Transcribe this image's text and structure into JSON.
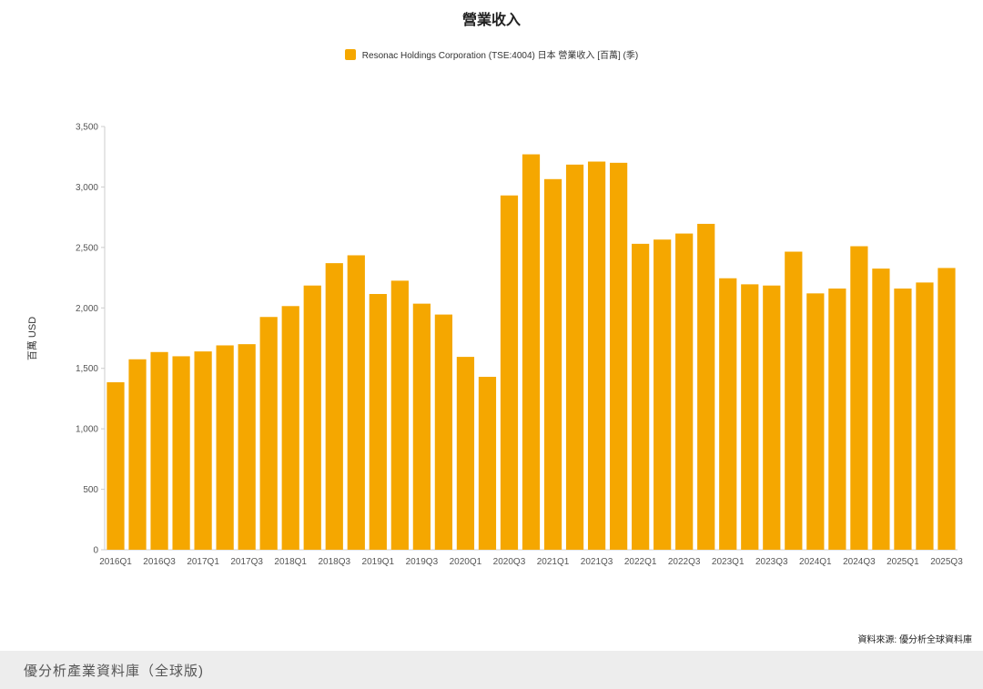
{
  "title": "營業收入",
  "legend_label": "Resonac Holdings Corporation (TSE:4004) 日本 營業收入 [百萬] (季)",
  "source_text": "資料來源: 優分析全球資料庫",
  "footer_text": "優分析產業資料庫（全球版)",
  "colors": {
    "bar": "#f5a700",
    "axis": "#cccccc",
    "text": "#555555"
  },
  "chart_data": {
    "type": "bar",
    "title": "營業收入",
    "ylabel": "百萬 USD",
    "xlabel": "",
    "ylim": [
      0,
      3500
    ],
    "yticks": [
      0,
      500,
      1000,
      1500,
      2000,
      2500,
      3000,
      3500
    ],
    "ytick_labels": [
      "0",
      "500",
      "1,000",
      "1,500",
      "2,000",
      "2,500",
      "3,000",
      "3,500"
    ],
    "grid": false,
    "legend_position": "top-center",
    "categories": [
      "2016Q1",
      "2016Q2",
      "2016Q3",
      "2016Q4",
      "2017Q1",
      "2017Q2",
      "2017Q3",
      "2017Q4",
      "2018Q1",
      "2018Q2",
      "2018Q3",
      "2018Q4",
      "2019Q1",
      "2019Q2",
      "2019Q3",
      "2019Q4",
      "2020Q1",
      "2020Q2",
      "2020Q3",
      "2020Q4",
      "2021Q1",
      "2021Q2",
      "2021Q3",
      "2021Q4",
      "2022Q1",
      "2022Q2",
      "2022Q3",
      "2022Q4",
      "2023Q1",
      "2023Q2",
      "2023Q3",
      "2023Q4",
      "2024Q1",
      "2024Q2",
      "2024Q3",
      "2024Q4",
      "2025Q1",
      "2025Q2",
      "2025Q3"
    ],
    "xtick_labels": [
      "2016Q1",
      "2016Q3",
      "2017Q1",
      "2017Q3",
      "2018Q1",
      "2018Q3",
      "2019Q1",
      "2019Q3",
      "2020Q1",
      "2020Q3",
      "2021Q1",
      "2021Q3",
      "2022Q1",
      "2022Q3",
      "2023Q1",
      "2023Q3",
      "2024Q1",
      "2024Q3",
      "2025Q1",
      "2025Q3"
    ],
    "series": [
      {
        "name": "Resonac Holdings Corporation (TSE:4004) 日本 營業收入 [百萬] (季)",
        "values": [
          1385,
          1575,
          1635,
          1600,
          1640,
          1690,
          1700,
          1925,
          2015,
          2185,
          2370,
          2435,
          2115,
          2225,
          2035,
          1945,
          1595,
          1430,
          2930,
          3270,
          3065,
          3185,
          3210,
          3200,
          2530,
          2565,
          2615,
          2695,
          2245,
          2195,
          2185,
          2465,
          2120,
          2160,
          2510,
          2325,
          2160,
          2210,
          2330
        ]
      }
    ]
  }
}
